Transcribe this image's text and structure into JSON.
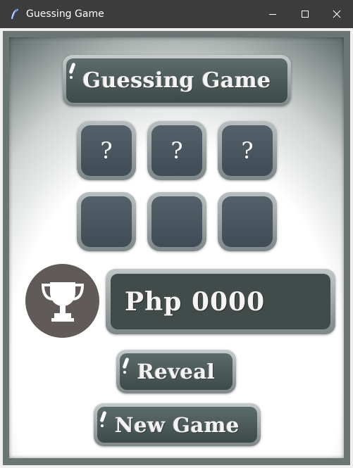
{
  "window": {
    "title": "Guessing Game",
    "icons": {
      "app": "feather-icon",
      "minimize": "minimize-icon",
      "maximize": "maximize-icon",
      "close": "close-icon"
    }
  },
  "game": {
    "title": "Guessing Game",
    "hidden_slots": [
      "?",
      "?",
      "?"
    ],
    "guess_slots": [
      "",
      "",
      ""
    ],
    "prize": "Php 0000",
    "prize_icon": "trophy-icon",
    "reveal_label": "Reveal",
    "new_game_label": "New Game"
  },
  "colors": {
    "titlebar": "#3c3c3c",
    "frame": "#6b7674",
    "tile": "#4a5660",
    "button": "#4a5856",
    "trophy_bg": "#605b58"
  }
}
